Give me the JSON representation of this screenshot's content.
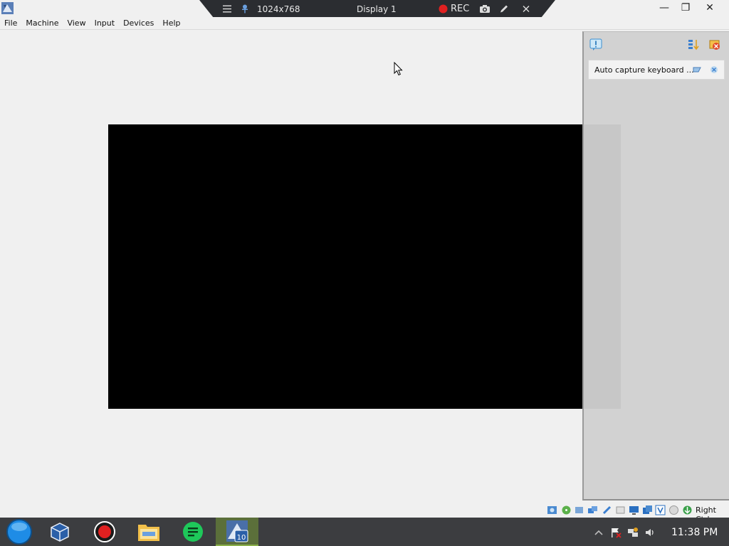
{
  "window": {
    "app_icon": "virtualbox-icon",
    "minimize_glyph": "—",
    "restore_glyph": "❐",
    "close_glyph": "✕"
  },
  "rec_toolbar": {
    "resolution": "1024x768",
    "display_name": "Display 1",
    "rec_label": "REC",
    "rec_color": "#e02020"
  },
  "menu": {
    "items": [
      "File",
      "Machine",
      "View",
      "Input",
      "Devices",
      "Help"
    ]
  },
  "notification": {
    "message": "Auto capture keyboard ..."
  },
  "statusbar": {
    "host_key": "Right Ctrl"
  },
  "taskbar": {
    "clock": "11:38 PM",
    "start_color": "#1e8ce6",
    "active_color": "#5b6f3a"
  }
}
